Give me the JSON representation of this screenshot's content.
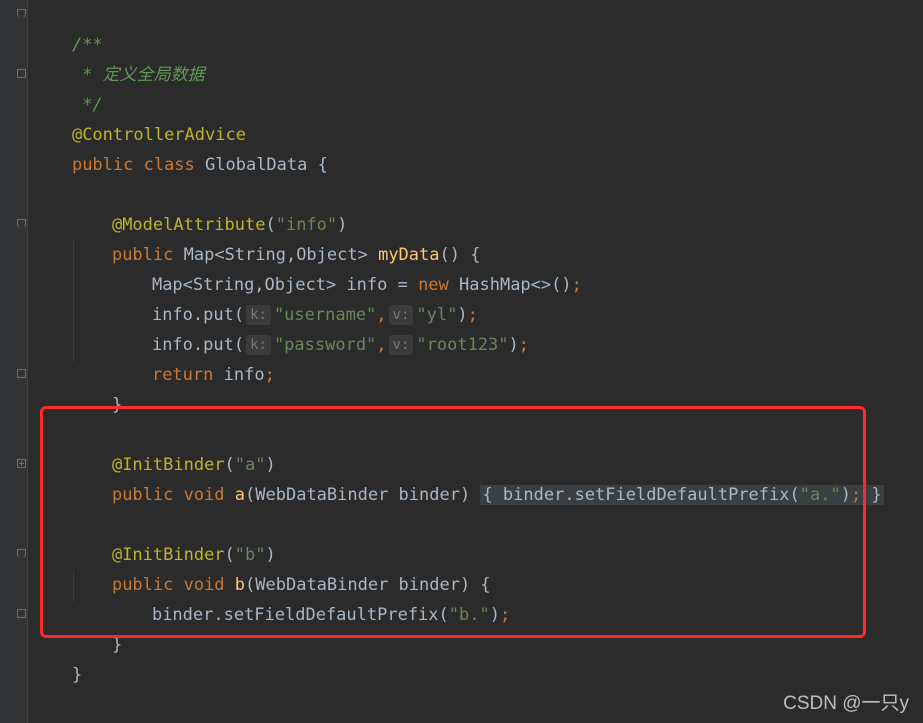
{
  "editor": {
    "lines": {
      "l1": "/**",
      "l2_prefix": " * ",
      "l2_text": "定义全局数据",
      "l3": " */",
      "l4": "@ControllerAdvice",
      "l5_kw": "public class",
      "l5_rest": " GlobalData {",
      "l7_ann": "@ModelAttribute",
      "l7_open": "(",
      "l7_str": "\"info\"",
      "l7_close": ")",
      "l8_kw": "public",
      "l8_type": " Map<String,Object> ",
      "l8_fn": "myData",
      "l8_rest": "() {",
      "l9_type": "Map<String,Object> info = ",
      "l9_kw": "new",
      "l9_rest": " HashMap<>()",
      "l9_semi": ";",
      "l10_call": "info.put(",
      "l10_hint_k": "k:",
      "l10_str1": "\"username\"",
      "l10_comma": ",",
      "l10_hint_v": "v:",
      "l10_str2": "\"yl\"",
      "l10_end": ")",
      "l10_semi": ";",
      "l11_call": "info.put(",
      "l11_hint_k": "k:",
      "l11_str1": "\"password\"",
      "l11_comma": ",",
      "l11_hint_v": "v:",
      "l11_str2": "\"root123\"",
      "l11_end": ")",
      "l11_semi": ";",
      "l12_kw": "return",
      "l12_rest": " info",
      "l12_semi": ";",
      "l13": "}",
      "l15_ann": "@InitBinder",
      "l15_open": "(",
      "l15_str": "\"a\"",
      "l15_close": ")",
      "l16_kw": "public void",
      "l16_fn": " a",
      "l16_rest": "(WebDataBinder binder) ",
      "l16_brace_open": "{",
      "l16_body": " binder.setFieldDefaultPrefix(",
      "l16_str": "\"a.\"",
      "l16_close": ")",
      "l16_semi": ";",
      "l16_brace_close": " }",
      "l18_ann": "@InitBinder",
      "l18_open": "(",
      "l18_str": "\"b\"",
      "l18_close": ")",
      "l19_kw": "public void",
      "l19_fn": " b",
      "l19_rest": "(WebDataBinder binder) {",
      "l20_body": "binder.setFieldDefaultPrefix(",
      "l20_str": "\"b.\"",
      "l20_close": ")",
      "l20_semi": ";",
      "l21": "}",
      "l22": "}"
    }
  },
  "watermark": "CSDN @一只y",
  "colors": {
    "background": "#2b2b2b",
    "keyword": "#cc7832",
    "string": "#6a8759",
    "annotation": "#bbb529",
    "function": "#ffc66d",
    "comment": "#629755",
    "highlight_box": "#ff2a2a"
  }
}
